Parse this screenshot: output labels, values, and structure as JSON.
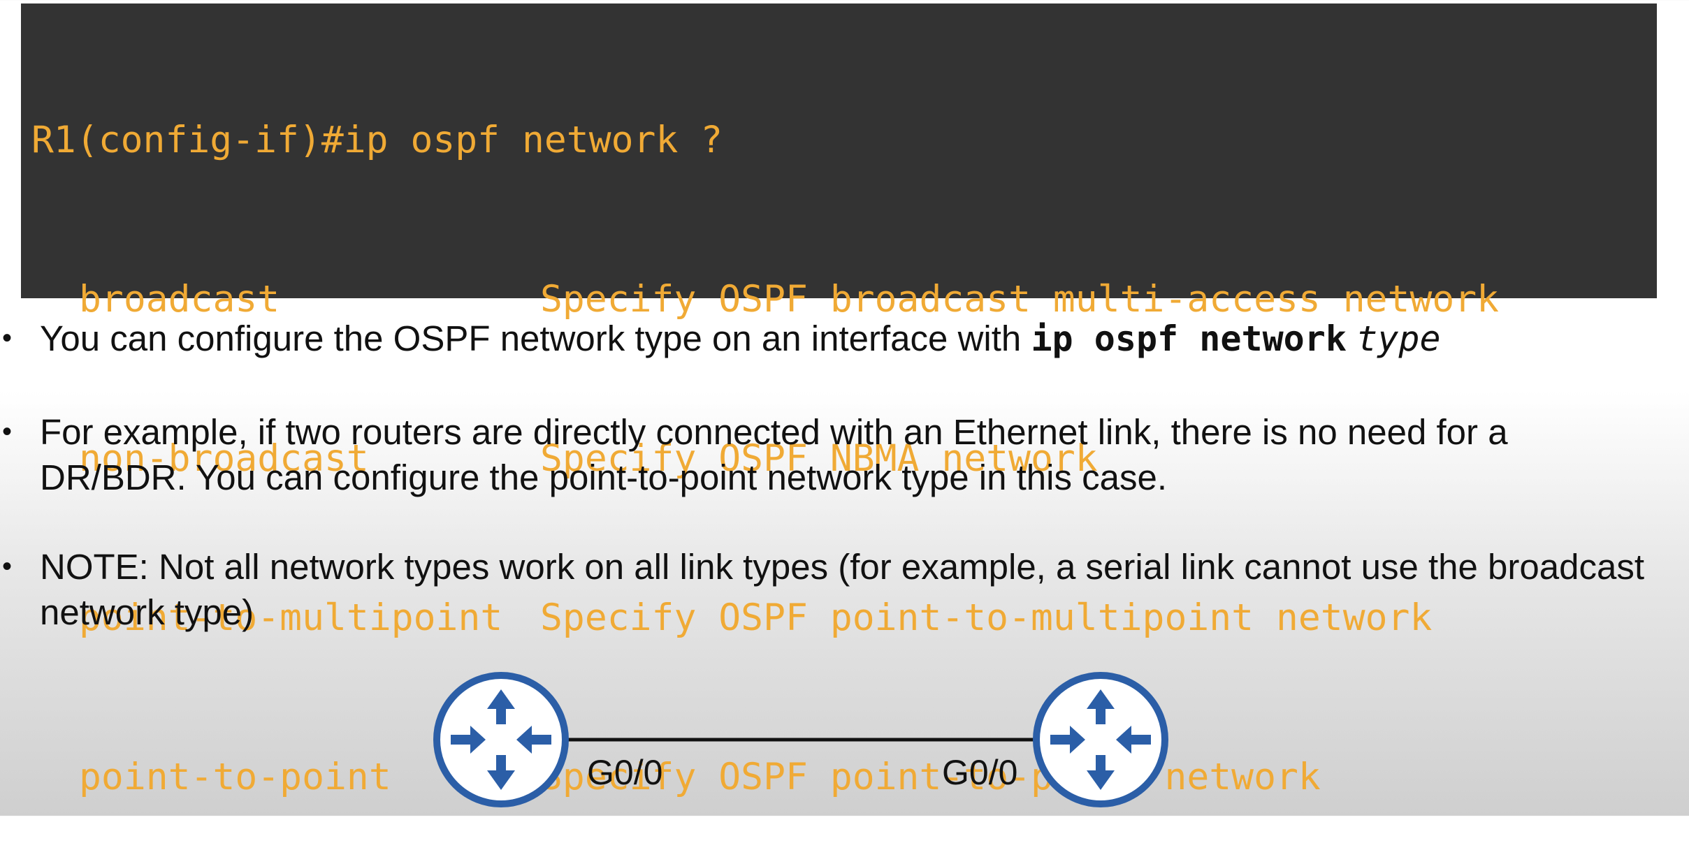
{
  "terminal": {
    "prompt_line": "R1(config-if)#ip ospf network ?",
    "options": [
      {
        "name": "broadcast",
        "description": "Specify OSPF broadcast multi-access network"
      },
      {
        "name": "non-broadcast",
        "description": "Specify OSPF NBMA network"
      },
      {
        "name": "point-to-multipoint",
        "description": "Specify OSPF point-to-multipoint network"
      },
      {
        "name": "point-to-point",
        "description": "Specify OSPF point-to-point network"
      }
    ]
  },
  "bullets": {
    "b1_text": "You can configure the OSPF network type on an interface with ",
    "b1_cmd": "ip ospf network",
    "b1_arg": "type",
    "b2_text": "For example, if two routers are directly connected with an Ethernet link, there is no need for a DR/BDR.  You can configure the point-to-point network type in this case.",
    "b3_text": "NOTE: Not all network types work on all link types (for example, a serial link cannot use the broadcast network type)"
  },
  "diagram": {
    "left_interface": "G0/0",
    "right_interface": "G0/0",
    "router_color": "#2b5ea7"
  }
}
